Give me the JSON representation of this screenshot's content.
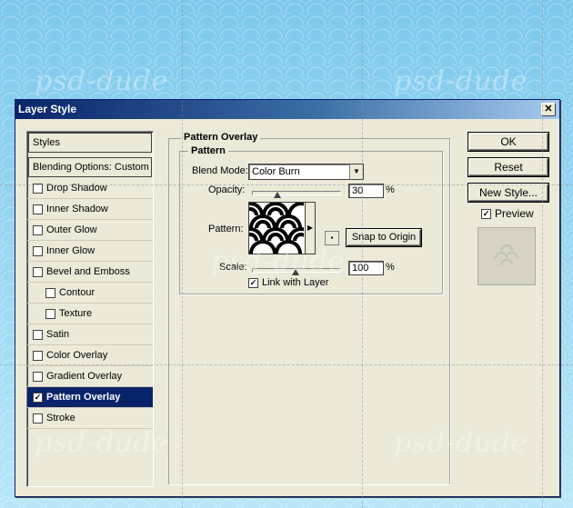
{
  "watermark": "psd-dude",
  "window": {
    "title": "Layer Style",
    "close_label": "✕"
  },
  "sidebar": {
    "styles_header": "Styles",
    "blending_options": "Blending Options: Custom",
    "items": [
      {
        "label": "Drop Shadow",
        "checked": false
      },
      {
        "label": "Inner Shadow",
        "checked": false
      },
      {
        "label": "Outer Glow",
        "checked": false
      },
      {
        "label": "Inner Glow",
        "checked": false
      },
      {
        "label": "Bevel and Emboss",
        "checked": false
      },
      {
        "label": "Contour",
        "checked": false
      },
      {
        "label": "Texture",
        "checked": false
      },
      {
        "label": "Satin",
        "checked": false
      },
      {
        "label": "Color Overlay",
        "checked": false
      },
      {
        "label": "Gradient Overlay",
        "checked": false
      },
      {
        "label": "Pattern Overlay",
        "checked": true
      },
      {
        "label": "Stroke",
        "checked": false
      }
    ]
  },
  "pattern_overlay": {
    "section_title": "Pattern Overlay",
    "group_title": "Pattern",
    "blend_mode_label": "Blend Mode:",
    "blend_mode_value": "Color Burn",
    "opacity_label": "Opacity:",
    "opacity_value": "30",
    "opacity_unit": "%",
    "opacity_fraction": 0.3,
    "pattern_label": "Pattern:",
    "snap_button": "Snap to Origin",
    "scale_label": "Scale:",
    "scale_value": "100",
    "scale_unit": "%",
    "link_label": "Link with Layer",
    "link_checked": true
  },
  "buttons": {
    "ok": "OK",
    "reset": "Reset",
    "new_style": "New Style...",
    "preview_label": "Preview",
    "preview_checked": true
  },
  "colors": {
    "selected_bg": "#0a246a",
    "dialog_bg": "#ece9d8"
  }
}
